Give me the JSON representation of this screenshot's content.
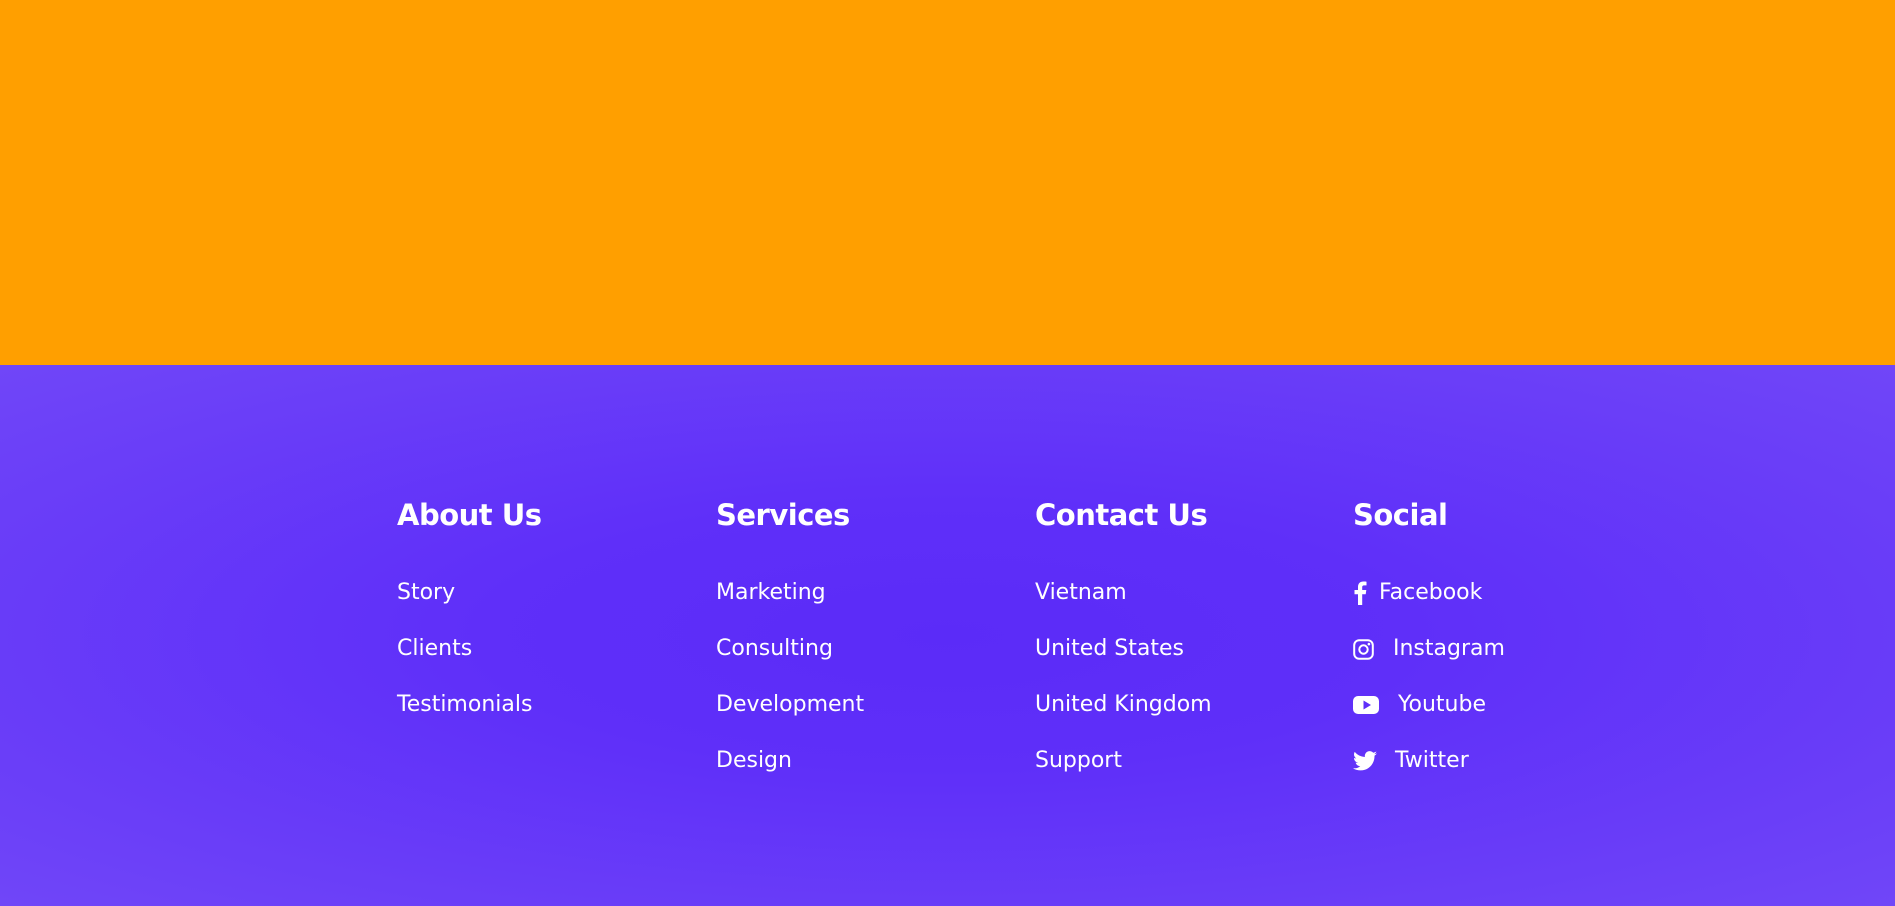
{
  "colors": {
    "hero_background": "#ff9f00",
    "footer_background": "#5f2ff9",
    "text": "#ffffff"
  },
  "footer": {
    "about": {
      "title": "About Us",
      "links": [
        "Story",
        "Clients",
        "Testimonials"
      ]
    },
    "services": {
      "title": "Services",
      "links": [
        "Marketing",
        "Consulting",
        "Development",
        "Design"
      ]
    },
    "contact": {
      "title": "Contact Us",
      "links": [
        "Vietnam",
        "United States",
        "United Kingdom",
        "Support"
      ]
    },
    "social": {
      "title": "Social",
      "links": [
        {
          "label": "Facebook",
          "icon": "facebook-icon"
        },
        {
          "label": "Instagram",
          "icon": "instagram-icon"
        },
        {
          "label": "Youtube",
          "icon": "youtube-icon"
        },
        {
          "label": "Twitter",
          "icon": "twitter-icon"
        }
      ]
    }
  }
}
